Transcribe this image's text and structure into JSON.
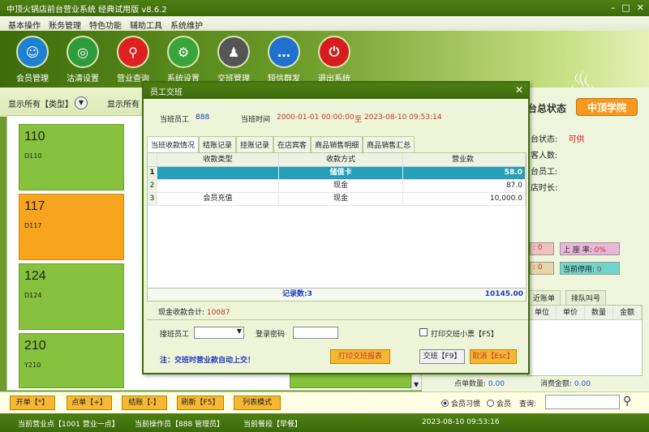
{
  "app": {
    "title": "中顶火锅店前台营业系统 经典试用版 v8.6.2"
  },
  "menu": [
    "基本操作",
    "账务管理",
    "特色功能",
    "辅助工具",
    "系统维护"
  ],
  "toolbar": [
    {
      "label": "会员管理",
      "icon": "member-icon",
      "color": "#1f7fd0"
    },
    {
      "label": "沽清设置",
      "icon": "plate-icon",
      "color": "#2f9c3b"
    },
    {
      "label": "营业查询",
      "icon": "magnifier-icon",
      "color": "#e02020"
    },
    {
      "label": "系统设置",
      "icon": "gear-icon",
      "color": "#3aa33a"
    },
    {
      "label": "交班管理",
      "icon": "people-icon",
      "color": "#555555"
    },
    {
      "label": "短信群发",
      "icon": "message-icon",
      "color": "#2070d0"
    },
    {
      "label": "退出系统",
      "icon": "power-icon",
      "color": "#d61d1d"
    }
  ],
  "filter": {
    "type_label": "显示所有【类型】",
    "region_label": "显示所有"
  },
  "tables": [
    {
      "name": "110",
      "code": "D110",
      "status": "free"
    },
    {
      "name": "117",
      "code": "D117",
      "status": "occupied"
    },
    {
      "name": "124",
      "code": "D124",
      "status": "free"
    },
    {
      "name": "210",
      "code": "Y210",
      "status": "free"
    }
  ],
  "right_panel": {
    "title": "台总状态",
    "brand": "中顶学院",
    "status_label": "台状态:",
    "status_value": "可供",
    "guests_label": "客人数:",
    "staff_label": "台员工:",
    "duration_label": "店时长:",
    "box_a": ": 0",
    "box_b_label": "上 座 率:",
    "box_b_value": "0%",
    "box_c": ": 0",
    "box_d_label": "当前停用:",
    "box_d_value": "0",
    "tabs": [
      "近账单",
      "排队叫号"
    ],
    "grid_headers": [
      "单位",
      "单价",
      "数量",
      "金额"
    ],
    "qty_label": "点单数量:",
    "qty_value": "0.00",
    "amount_label": "消费金额:",
    "amount_value": "0.00"
  },
  "bottom": {
    "buttons": [
      "开单【*】",
      "点单【+】",
      "结账【-】",
      "刷新【F5】",
      "列表模式"
    ],
    "radio_habit": "会员习惯",
    "radio_member": "会员",
    "search_label": "查询:"
  },
  "status": {
    "point": "当前营业点【1001 营业一点】",
    "operator": "当前操作员【888 管理员】",
    "meal": "当前餐段【早餐】",
    "datetime": "2023-08-10 09:53:16"
  },
  "modal": {
    "title": "员工交班",
    "staff_label": "当班员工",
    "staff_value": "888",
    "time_label": "当班时间",
    "time_start": "2000-01-01 00:00:00",
    "time_to": "至",
    "time_end": "2023-08-10 09:53:14",
    "tabs": [
      "当班收款情况",
      "结账记录",
      "挂账记录",
      "在店宾客",
      "商品销售明细",
      "商品销售汇总"
    ],
    "headers": [
      "收款类型",
      "收款方式",
      "营业款"
    ],
    "rows": [
      {
        "n": "1",
        "type": "",
        "method": "储值卡",
        "amount": "58.0",
        "selected": true
      },
      {
        "n": "2",
        "type": "",
        "method": "现金",
        "amount": "87.0",
        "selected": false
      },
      {
        "n": "3",
        "type": "会员充值",
        "method": "现金",
        "amount": "10,000.0",
        "selected": false
      }
    ],
    "record_count": "记录数:3",
    "total": "10145.00",
    "cash_label": "现金收款合计:",
    "cash_value": "10087",
    "receiver_label": "接班员工",
    "password_label": "登录密码",
    "print_ticket": "打印交班小票【F5】",
    "note": "注：交班时营业款自动上交！",
    "btn_print": "打印交班报表",
    "btn_shift": "交班【F9】",
    "btn_cancel": "取消【Esc】"
  }
}
